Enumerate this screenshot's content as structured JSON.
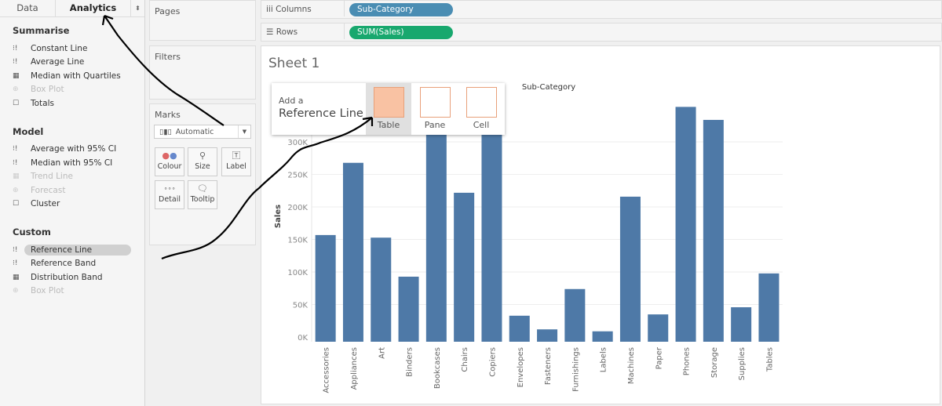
{
  "tabs": {
    "data": "Data",
    "analytics": "Analytics"
  },
  "summarise": {
    "title": "Summarise",
    "items": [
      {
        "label": "Constant Line",
        "icon": "constant-line-icon"
      },
      {
        "label": "Average Line",
        "icon": "average-line-icon"
      },
      {
        "label": "Median with Quartiles",
        "icon": "median-quartiles-icon"
      },
      {
        "label": "Box Plot",
        "icon": "box-plot-icon",
        "disabled": true
      },
      {
        "label": "Totals",
        "icon": "totals-icon"
      }
    ]
  },
  "model": {
    "title": "Model",
    "items": [
      {
        "label": "Average with 95% CI"
      },
      {
        "label": "Median with 95% CI"
      },
      {
        "label": "Trend Line",
        "disabled": true
      },
      {
        "label": "Forecast",
        "disabled": true
      },
      {
        "label": "Cluster"
      }
    ]
  },
  "custom": {
    "title": "Custom",
    "items": [
      {
        "label": "Reference Line",
        "selected": true
      },
      {
        "label": "Reference Band"
      },
      {
        "label": "Distribution Band"
      },
      {
        "label": "Box Plot",
        "disabled": true
      }
    ]
  },
  "cards": {
    "pages": "Pages",
    "filters": "Filters",
    "marks": "Marks",
    "mark_type": "Automatic",
    "colour": "Colour",
    "size": "Size",
    "label": "Label",
    "detail": "Detail",
    "tooltip": "Tooltip"
  },
  "shelves": {
    "columns_label": "Columns",
    "columns_pill": "Sub-Category",
    "rows_label": "Rows",
    "rows_pill": "SUM(Sales)",
    "columns_color": "#4a8db3",
    "rows_color": "#18a86e"
  },
  "sheet": {
    "title": "Sheet 1"
  },
  "popup": {
    "line1": "Add a",
    "line2": "Reference Line",
    "options": [
      "Table",
      "Pane",
      "Cell"
    ],
    "selected": "Table",
    "accent": "#f9c2a3"
  },
  "chart_data": {
    "type": "bar",
    "title": "Sub-Category",
    "xlabel": "",
    "ylabel": "Sales",
    "ylim": [
      0,
      370000
    ],
    "yticks": [
      "0K",
      "50K",
      "100K",
      "150K",
      "200K",
      "250K",
      "300K"
    ],
    "ytick_values": [
      0,
      50000,
      100000,
      150000,
      200000,
      250000,
      300000
    ],
    "grid": true,
    "bar_color": "#4e79a7",
    "categories": [
      "Accessories",
      "Appliances",
      "Art",
      "Binders",
      "Bookcases",
      "Chairs",
      "Copiers",
      "Envelopes",
      "Fasteners",
      "Furnishings",
      "Labels",
      "Machines",
      "Paper",
      "Phones",
      "Storage",
      "Supplies",
      "Tables"
    ],
    "values": [
      164000,
      275000,
      160000,
      100000,
      330000,
      229000,
      335000,
      40000,
      19000,
      81000,
      16000,
      223000,
      42000,
      361000,
      341000,
      53000,
      105000
    ]
  }
}
